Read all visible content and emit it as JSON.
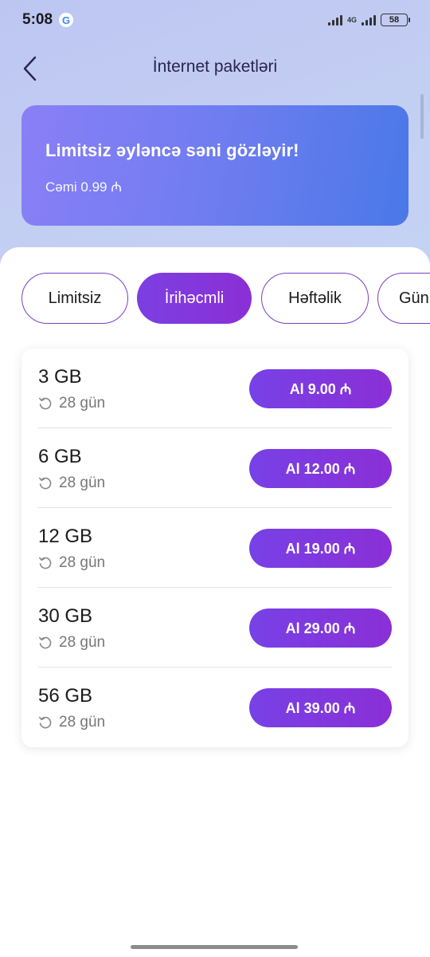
{
  "status_bar": {
    "time": "5:08",
    "google_letter": "G",
    "network_label": "4G",
    "battery": "58"
  },
  "header": {
    "title": "İnternet paketləri"
  },
  "banner": {
    "title": "Limitsiz əyləncə səni gözləyir!",
    "subtitle": "Cəmi 0.99 ₼"
  },
  "tabs": [
    {
      "label": "Limitsiz",
      "active": false
    },
    {
      "label": "İrihəcmli",
      "active": true
    },
    {
      "label": "Həftəlik",
      "active": false
    },
    {
      "label": "Gün",
      "active": false
    }
  ],
  "packages": [
    {
      "size": "3 GB",
      "duration": "28 gün",
      "button": "Al 9.00 ₼"
    },
    {
      "size": "6 GB",
      "duration": "28 gün",
      "button": "Al 12.00 ₼"
    },
    {
      "size": "12 GB",
      "duration": "28 gün",
      "button": "Al 19.00 ₼"
    },
    {
      "size": "30 GB",
      "duration": "28 gün",
      "button": "Al 29.00 ₼"
    },
    {
      "size": "56 GB",
      "duration": "28 gün",
      "button": "Al 39.00 ₼"
    }
  ],
  "colors": {
    "accent": "#7b3fc4",
    "button": "#7c3fe2",
    "banner_start": "#8a7ff6",
    "banner_end": "#4a78e8"
  }
}
